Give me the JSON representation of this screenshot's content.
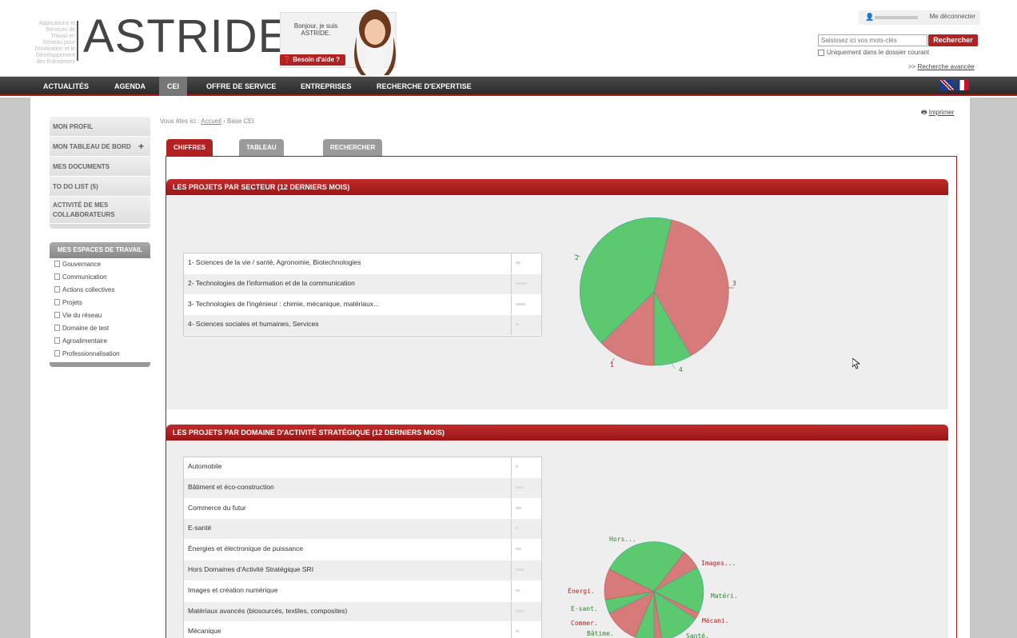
{
  "brand": {
    "tagline": "Applications et Services de Travail en Réseau pour l'Innovation et le Développement des Entreprises",
    "name": "ASTRIDE",
    "apostrophe": "'"
  },
  "help": {
    "greeting": "Bonjour, je suis ASTRIDE.",
    "button": "Besoin d'aide ?"
  },
  "user": {
    "logout": "Me déconnecter"
  },
  "search": {
    "placeholder": "Saisissez ici vos mots-clés",
    "button": "Rechercher",
    "checkbox_label": "Uniquement dans le dossier courant",
    "advanced_prefix": ">> ",
    "advanced": "Recherche avancée"
  },
  "nav": {
    "items": [
      "ACTUALITÉS",
      "AGENDA",
      "CEI",
      "OFFRE DE SERVICE",
      "ENTREPRISES",
      "RECHERCHE D'EXPERTISE"
    ],
    "active": "CEI"
  },
  "breadcrumb": {
    "prefix": "Vous êtes ici : ",
    "home": "Accueil",
    "sep": " › ",
    "current": "Base CEI"
  },
  "print": "Imprimer",
  "menu": {
    "items": [
      "MON PROFIL",
      "MON TABLEAU DE BORD",
      "MES DOCUMENTS",
      "TO DO LIST (5)",
      "ACTIVITÉ DE MES COLLABORATEURS"
    ],
    "plus": "+"
  },
  "spaces": {
    "title": "MES ESPACES DE TRAVAIL",
    "items": [
      "Gouvernance",
      "Communication",
      "Actions collectives",
      "Projets",
      "Vie du réseau",
      "Domaine de test",
      "Agroalimentaire",
      "Professionnalisation"
    ]
  },
  "tabs": [
    "CHIFFRES CLÉS",
    "TABLEAU DE BORD",
    "RECHERCHER / AJOUTER UN PROJET CEI"
  ],
  "panel1": {
    "title": "LES PROJETS PAR SECTEUR (12 DERNIERS MOIS)",
    "rows": [
      "1- Sciences de la vie / santé, Agronomie, Biotechnologies",
      "2- Technologies de l'information et de la communication",
      "3- Technologies de l'ingénieur : chimie, mécanique, matériaux...",
      "4- Sciences sociales et humaines, Services"
    ],
    "pie_labels": [
      "1",
      "2",
      "3",
      "4"
    ]
  },
  "panel2": {
    "title": "LES PROJETS PAR DOMAINE D'ACTIVITÉ STRATÉGIQUE (12 DERNIERS MOIS)",
    "rows": [
      "Automobile",
      "Bâtiment et éco-construction",
      "Commerce du futur",
      "E-santé",
      "Énergies et électronique de puissance",
      "Hors Domaines d'Activité Stratégique SRI",
      "Images et création numérique",
      "Matériaux avancés (biosourcés, textiles, composites)",
      "Mécanique"
    ],
    "pie_labels": [
      "Hors...",
      "Images...",
      "Matéri.",
      "Mécani.",
      "Santé.",
      "Bâtime.",
      "Commer.",
      "E-sant.",
      "Énergi."
    ]
  },
  "colors": {
    "brand_red": "#b22222",
    "pie_green": "#5cc870",
    "pie_red": "#d77a7a"
  }
}
